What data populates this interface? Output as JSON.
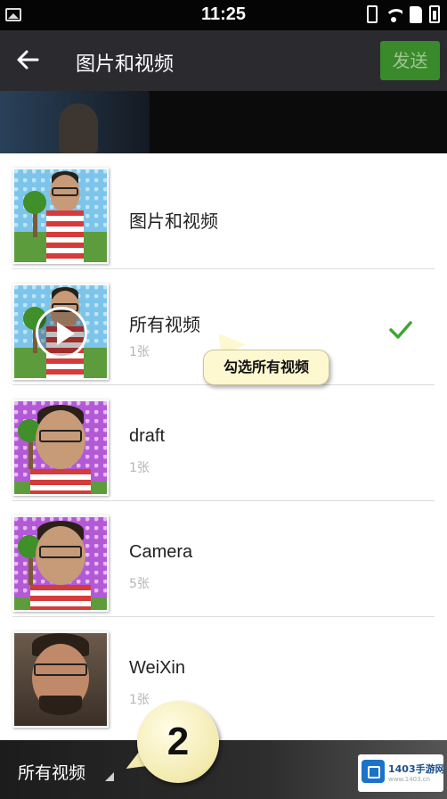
{
  "status_bar": {
    "time": "11:25",
    "icons": [
      "gallery-icon",
      "vibrate-icon",
      "wifi-icon",
      "sd-card-icon",
      "battery-icon"
    ]
  },
  "action_bar": {
    "back_icon": "arrow-left-icon",
    "title": "图片和视频",
    "send_label": "发送",
    "send_color": "#3a8a2c"
  },
  "albums": [
    {
      "name": "图片和视频",
      "count": "",
      "selected": false,
      "thumb": "blue"
    },
    {
      "name": "所有视频",
      "count": "1张",
      "selected": true,
      "thumb": "blue-video"
    },
    {
      "name": "draft",
      "count": "1张",
      "selected": false,
      "thumb": "purple"
    },
    {
      "name": "Camera",
      "count": "5张",
      "selected": false,
      "thumb": "purple"
    },
    {
      "name": "WeiXin",
      "count": "1张",
      "selected": false,
      "thumb": "photo"
    }
  ],
  "check_color": "#3fa535",
  "callout": {
    "text": "勾选所有视频"
  },
  "bottom_bar": {
    "folder_label": "所有视频"
  },
  "step_badge": {
    "number": "2"
  },
  "watermark": {
    "brand": "1403手游网",
    "url": "www.1403.cn"
  }
}
